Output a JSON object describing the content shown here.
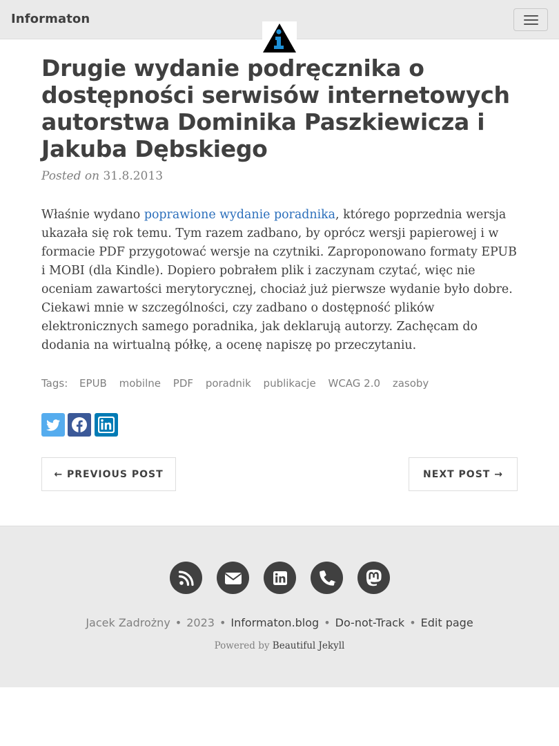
{
  "navbar": {
    "brand": "Informaton",
    "menu_icon": "hamburger-menu-icon",
    "avatar_icon": "info-triangle-logo"
  },
  "post": {
    "title": "Drugie wydanie podręcznika o dostępności serwisów internetowych autorstwa Dominika Paszkiewicza i Jakuba Dębskiego",
    "posted_on": "Posted on",
    "date": "31.8.2013",
    "body_before_link": "Właśnie wydano ",
    "body_link": "poprawione wydanie poradnika",
    "body_after_link": ", którego poprzednia wersja ukazała się rok temu. Tym razem zadbano, by oprócz wersji papierowej i w formacie PDF przygotować wersje na czytniki. Zaproponowano formaty EPUB i MOBI (dla Kindle). Dopiero pobrałem plik i zaczynam czytać, więc nie oceniam zawartości merytorycznej, chociaż już pierwsze wydanie było dobre. Ciekawi mnie w szczególności, czy zadbano o dostępność plików elektronicznych samego poradnika, jak deklarują autorzy. Zachęcam do dodania na wirtualną półkę, a ocenę napiszę po przeczytaniu.",
    "tags_label": "Tags:",
    "tags": [
      "EPUB",
      "mobilne",
      "PDF",
      "poradnik",
      "publikacje",
      "WCAG 2.0",
      "zasoby"
    ]
  },
  "share": {
    "twitter_icon": "twitter-icon",
    "facebook_icon": "facebook-icon",
    "linkedin_icon": "linkedin-icon",
    "colors": {
      "twitter": "#55acee",
      "facebook": "#3b5998",
      "linkedin": "#007bb5"
    }
  },
  "pager": {
    "previous": "← PREVIOUS POST",
    "next": "NEXT POST →"
  },
  "footer": {
    "icons": [
      "rss-icon",
      "envelope-icon",
      "linkedin-icon",
      "phone-icon",
      "mastodon-icon"
    ],
    "author": "Jacek Zadrożny",
    "year": "2023",
    "site": "Informaton.blog",
    "dnt": "Do-not-Track",
    "edit": "Edit page",
    "powered_by": "Powered by",
    "powered_link": "Beautiful Jekyll",
    "bullet": "•"
  }
}
